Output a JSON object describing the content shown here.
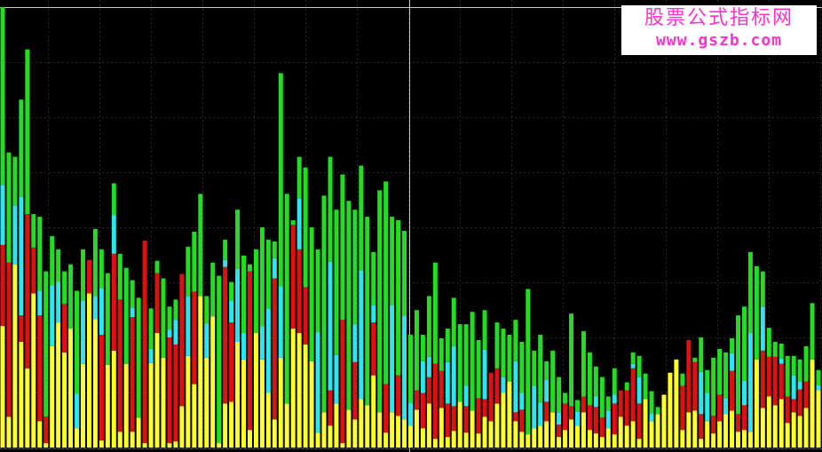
{
  "watermark": {
    "title": "股票公式指标网",
    "url": "www.gszb.com"
  },
  "chart_data": {
    "type": "bar",
    "stacked": true,
    "ylim": [
      0,
      500
    ],
    "grid": true,
    "legend": "none",
    "colors": {
      "background": "#000000",
      "grid": "#2a2a2a",
      "crosshair": "#c8c8c8",
      "yellow": "#ffff2a",
      "red": "#e01010",
      "cyan": "#2ae8f0",
      "green": "#22dd22"
    },
    "series": [
      {
        "color_key": "yellow",
        "values": [
          138,
          35,
          208,
          120,
          90,
          175,
          30,
          5,
          115,
          142,
          108,
          135,
          22,
          95,
          175,
          146,
          8,
          94,
          110,
          18,
          95,
          18,
          34,
          5,
          96,
          130,
          102,
          5,
          7,
          47,
          104,
          72,
          172,
          102,
          149,
          5,
          50,
          52,
          120,
          100,
          20,
          130,
          100,
          62,
          32,
          102,
          50,
          135,
          130,
          117,
          98,
          17,
          40,
          25,
          50,
          5,
          43,
          32,
          55,
          48,
          82,
          40,
          17,
          40,
          36,
          32,
          25,
          43,
          22,
          50,
          10,
          45,
          12,
          19,
          52,
          17,
          42,
          16,
          35,
          30,
          50,
          62,
          75,
          30,
          18,
          15,
          22,
          25,
          30,
          40,
          12,
          20,
          32,
          25,
          40,
          20,
          16,
          12,
          22,
          15,
          35,
          25,
          30,
          10,
          55,
          30,
          38,
          60,
          85,
          100,
          20,
          40,
          42,
          10,
          30,
          16,
          30,
          38,
          42,
          18,
          20,
          18,
          100,
          45,
          58,
          48,
          55,
          28,
          40,
          36,
          45,
          100,
          65
        ],
        "y0": [
          0,
          0,
          0,
          0,
          0,
          0,
          0,
          0,
          0,
          0,
          0,
          0,
          0,
          0,
          0,
          0,
          0,
          0,
          0,
          0,
          0,
          0,
          0,
          0,
          0,
          0,
          0,
          0,
          0,
          0,
          0,
          0,
          0,
          0,
          0,
          0,
          0,
          0,
          0,
          0,
          0,
          0,
          0,
          0,
          0,
          0,
          0,
          0,
          0,
          0,
          0,
          0,
          0,
          0,
          0,
          0,
          0,
          0,
          0,
          0,
          0,
          0,
          0,
          0,
          0,
          0,
          0,
          0,
          0,
          0,
          0,
          0,
          0,
          0,
          0,
          0,
          0,
          0,
          0,
          0,
          0,
          0,
          0,
          0,
          0,
          0,
          0,
          0,
          0,
          0,
          0,
          0,
          0,
          0,
          0,
          0,
          0,
          0,
          0,
          0,
          0,
          0,
          0,
          0,
          0,
          0,
          0,
          0,
          0,
          0,
          0,
          0,
          0,
          0,
          0,
          0,
          0,
          0,
          0,
          0,
          0,
          0,
          0,
          0,
          0,
          0,
          0,
          0,
          0,
          0,
          0,
          0,
          0
        ]
      }
    ]
  }
}
